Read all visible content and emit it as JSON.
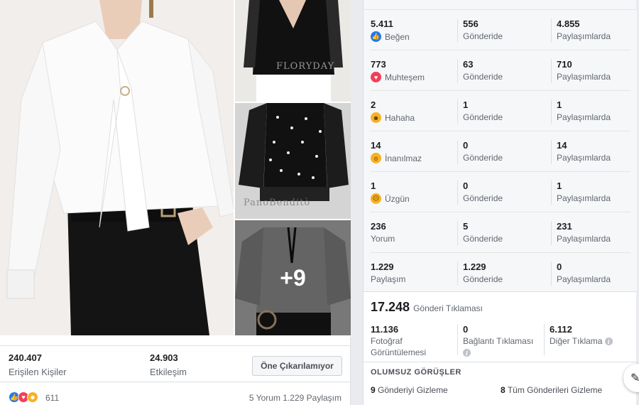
{
  "post": {
    "more_photos_label": "+9",
    "watermarks": [
      "FLORYDAY",
      "PanoBenditò"
    ],
    "stats": {
      "reach_value": "240.407",
      "reach_label": "Erişilen Kişiler",
      "engagement_value": "24.903",
      "engagement_label": "Etkileşim"
    },
    "boost_button_label": "Öne Çıkarılamıyor",
    "reactions_count": "611",
    "comments_shares": "5 Yorum  1.229 Paylaşım",
    "reaction_icons": [
      "like-icon",
      "love-icon",
      "haha-icon"
    ]
  },
  "insights": {
    "rows": [
      {
        "icon": "like-icon",
        "total": "5.411",
        "label": "Beğen",
        "on_post": "556",
        "on_post_label": "Gönderide",
        "on_shares": "4.855",
        "on_shares_label": "Paylaşımlarda"
      },
      {
        "icon": "love-icon",
        "total": "773",
        "label": "Muhteşem",
        "on_post": "63",
        "on_post_label": "Gönderide",
        "on_shares": "710",
        "on_shares_label": "Paylaşımlarda"
      },
      {
        "icon": "haha-icon",
        "total": "2",
        "label": "Hahaha",
        "on_post": "1",
        "on_post_label": "Gönderide",
        "on_shares": "1",
        "on_shares_label": "Paylaşımlarda"
      },
      {
        "icon": "wow-icon",
        "total": "14",
        "label": "İnanılmaz",
        "on_post": "0",
        "on_post_label": "Gönderide",
        "on_shares": "14",
        "on_shares_label": "Paylaşımlarda"
      },
      {
        "icon": "sad-icon",
        "total": "1",
        "label": "Üzgün",
        "on_post": "0",
        "on_post_label": "Gönderide",
        "on_shares": "1",
        "on_shares_label": "Paylaşımlarda"
      },
      {
        "icon": "",
        "total": "236",
        "label": "Yorum",
        "on_post": "5",
        "on_post_label": "Gönderide",
        "on_shares": "231",
        "on_shares_label": "Paylaşımlarda"
      },
      {
        "icon": "",
        "total": "1.229",
        "label": "Paylaşım",
        "on_post": "1.229",
        "on_post_label": "Gönderide",
        "on_shares": "0",
        "on_shares_label": "Paylaşımlarda"
      }
    ],
    "clicks": {
      "total": "17.248",
      "total_label": "Gönderi Tıklaması",
      "photo_views": "11.136",
      "photo_views_label_1": "Fotoğraf",
      "photo_views_label_2": "Görüntülemesi",
      "link_clicks": "0",
      "link_clicks_label": "Bağlantı Tıklaması",
      "other_clicks": "6.112",
      "other_clicks_label": "Diğer Tıklama"
    },
    "negative": {
      "heading": "OLUMSUZ GÖRÜŞLER",
      "hide_post_count": "9",
      "hide_post_label": "Gönderiyi Gizleme",
      "hide_all_count": "8",
      "hide_all_label": "Tüm Gönderileri Gizleme"
    }
  },
  "colors": {
    "like": "#2078f4",
    "love": "#f33e58",
    "emoji_yellow": "#f7b125",
    "muted_text": "#606770"
  }
}
